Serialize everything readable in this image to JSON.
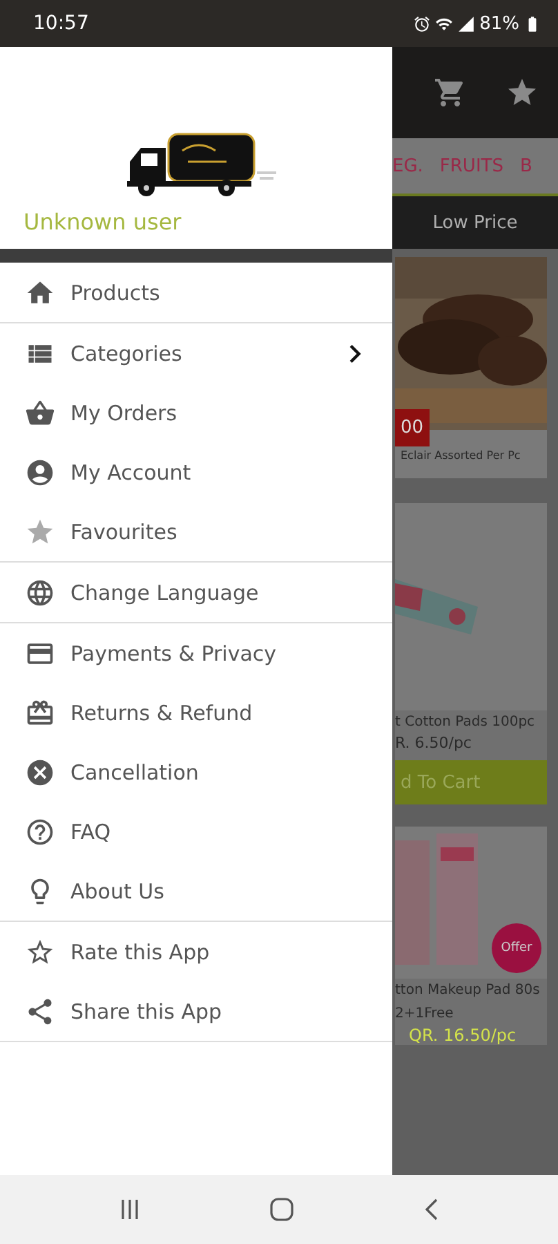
{
  "status_bar": {
    "time": "10:57",
    "battery": "81%"
  },
  "drawer": {
    "user": "Unknown user",
    "groups": [
      {
        "items": [
          {
            "label": "Products",
            "expandable": false
          }
        ]
      },
      {
        "items": [
          {
            "label": "Categories",
            "expandable": true
          },
          {
            "label": "My Orders",
            "expandable": false
          },
          {
            "label": "My Account",
            "expandable": false
          },
          {
            "label": "Favourites",
            "expandable": false
          }
        ]
      },
      {
        "items": [
          {
            "label": "Change Language",
            "expandable": false
          }
        ]
      },
      {
        "items": [
          {
            "label": "Payments & Privacy",
            "expandable": false
          },
          {
            "label": "Returns & Refund",
            "expandable": false
          },
          {
            "label": "Cancellation",
            "expandable": false
          },
          {
            "label": "FAQ",
            "expandable": false
          },
          {
            "label": "About Us",
            "expandable": false
          }
        ]
      },
      {
        "items": [
          {
            "label": "Rate this App",
            "expandable": false
          },
          {
            "label": "Share this App",
            "expandable": false
          }
        ]
      }
    ]
  },
  "category_tabs": [
    "EG.",
    "FRUITS",
    "B"
  ],
  "sort_bar": {
    "label": "Low Price"
  },
  "products": [
    {
      "kind": "banner",
      "badge": "00",
      "name": "Eclair Assorted Per Pc"
    },
    {
      "kind": "item",
      "name": "t Cotton Pads 100pc",
      "price": "R. 6.50/pc",
      "button": "d To Cart"
    },
    {
      "kind": "offer",
      "badge": "Offer",
      "name": "tton Makeup Pad 80s",
      "note": "2+1Free",
      "price": "QR. 16.50/pc"
    }
  ]
}
